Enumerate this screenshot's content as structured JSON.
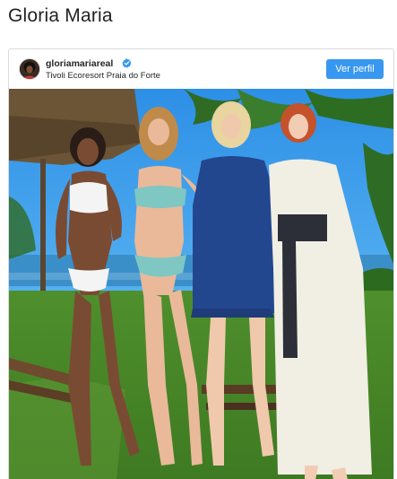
{
  "page": {
    "title": "Gloria Maria"
  },
  "post": {
    "username": "gloriamariareal",
    "verified": true,
    "location": "Tivoli Ecoresort Praia do Forte",
    "profile_button_label": "Ver perfil"
  },
  "colors": {
    "button_blue": "#3897f0",
    "verified_blue": "#3897f0",
    "border": "#dbdbdb"
  },
  "icons": {
    "verified": "verified-badge-icon"
  }
}
